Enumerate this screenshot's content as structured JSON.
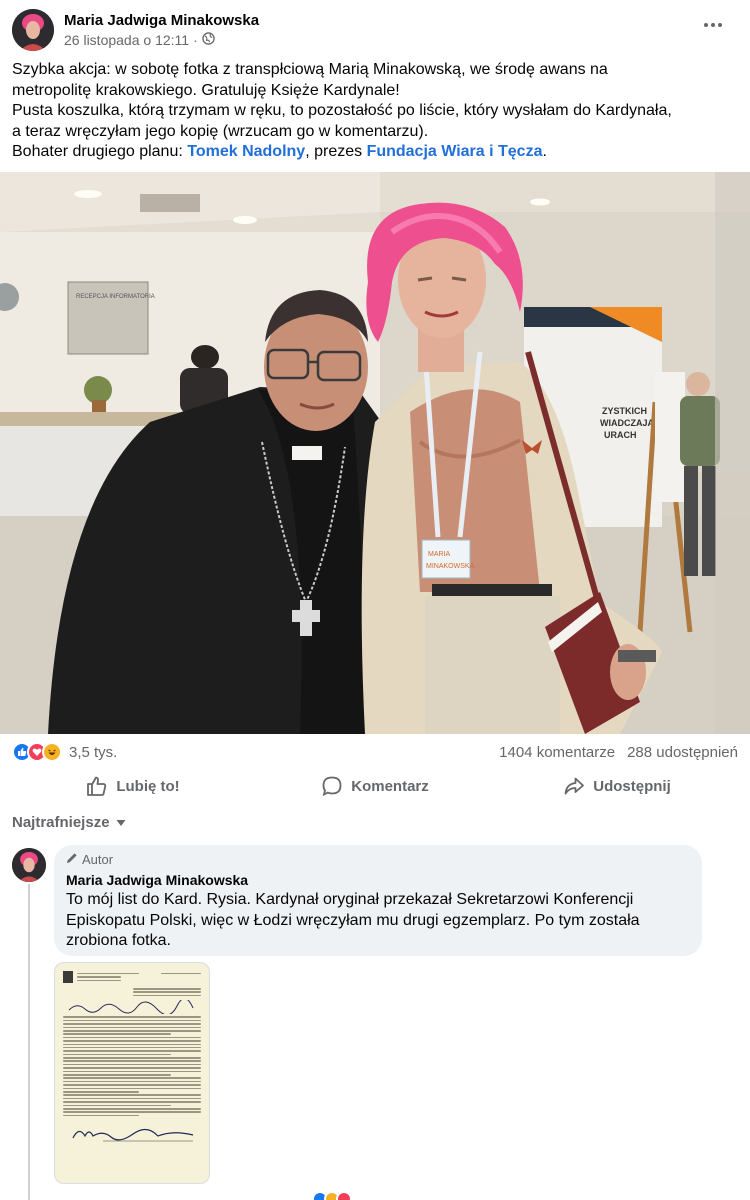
{
  "post": {
    "author": "Maria Jadwiga Minakowska",
    "timestamp": "26 listopada o 12:11",
    "privacy_icon": "globe-icon",
    "text_lines": [
      "Szybka akcja: w sobotę fotka z transpłciową Marią Minakowską, we środę awans na",
      "metropolitę krakowskiego. Gratuluję Księże Kardynale!",
      "Pusta koszulka, którą trzymam w ręku, to pozostałość po liście, który wysłałam do Kardynała,",
      "a teraz wręczyłam jego kopię (wrzucam go w komentarzu)."
    ],
    "last_line_prefix": "Bohater drugiego planu: ",
    "mention_person": "Tomek Nadolny",
    "last_line_middle": ", prezes ",
    "mention_org": "Fundacja Wiara i Tęcza",
    "last_line_suffix": "."
  },
  "photo": {
    "reception_sign": "RECEPCJA INFORMATORIA",
    "badge_line1": "MARIA",
    "badge_line2": "MINAKOWSKA",
    "banner_line1": "ZYSTKICH",
    "banner_line2": "WIADCZAJĄ",
    "banner_line3": "URACH"
  },
  "stats": {
    "reactions_count": "3,5 tys.",
    "comments": "1404 komentarze",
    "shares": "288 udostępnień"
  },
  "actions": {
    "like": "Lubię to!",
    "comment": "Komentarz",
    "share": "Udostępnij"
  },
  "sort": {
    "label": "Najtrafniejsze"
  },
  "comment": {
    "badge": "Autor",
    "author": "Maria Jadwiga Minakowska",
    "text_lines": [
      "To mój list do Kard. Rysia. Kardynał oryginał przekazał Sekretarzowi Konferencji",
      "Episkopatu Polski, więc w Łodzi wręczyłam mu drugi egzemplarz. Po tym została",
      "zrobiona fotka."
    ]
  },
  "colors": {
    "link": "#216fdb",
    "secondary_text": "#65676b",
    "comment_bubble": "#eff2f5",
    "like_blue": "#1877f2",
    "love_red": "#f33e58",
    "haha_yellow": "#f7b125"
  }
}
